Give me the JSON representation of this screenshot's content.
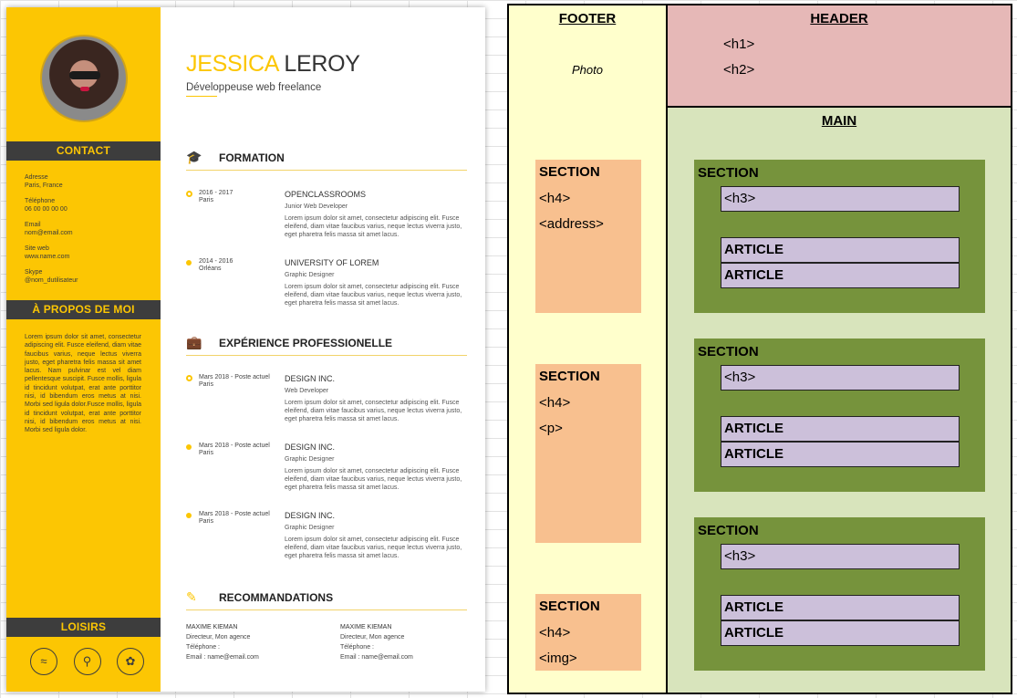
{
  "cv": {
    "first_name": "JESSICA",
    "last_name": "LEROY",
    "job_title": "Développeuse web freelance",
    "contact_title": "CONTACT",
    "contacts": [
      {
        "label": "Adresse",
        "value": "Paris, France"
      },
      {
        "label": "Téléphone",
        "value": "06 00 00 00 00"
      },
      {
        "label": "Email",
        "value": "nom@email.com"
      },
      {
        "label": "Site web",
        "value": "www.name.com"
      },
      {
        "label": "Skype",
        "value": "@nom_dutilisateur"
      }
    ],
    "about_title": "À PROPOS DE MOI",
    "about_text": "Lorem ipsum dolor sit amet, consectetur adipiscing elit. Fusce eleifend, diam vitae faucibus varius, neque lectus viverra justo, eget pharetra felis massa sit amet lacus. Nam pulvinar est vel diam pellentesque suscipit. Fusce mollis, ligula id tincidunt volutpat, erat ante porttitor nisi, id bibendum eros metus at nisi. Morbi sed ligula dolor.Fusce mollis, ligula id tincidunt volutpat, erat ante porttitor nisi, id bibendum eros metus at nisi. Morbi sed ligula dolor.",
    "hobbies_title": "LOISIRS",
    "hobby_icons": [
      "swimming-icon",
      "cycling-icon",
      "running-icon"
    ],
    "education_title": "FORMATION",
    "education": [
      {
        "date": "2016 - 2017",
        "place": "Paris",
        "org": "OPENCLASSROOMS",
        "role": "Junior Web Developer",
        "desc": "Lorem ipsum dolor sit amet, consectetur adipiscing elit. Fusce eleifend, diam vitae faucibus varius, neque lectus viverra justo, eget pharetra felis massa sit amet lacus."
      },
      {
        "date": "2014 - 2016",
        "place": "Orléans",
        "org": "UNIVERSITY OF LOREM",
        "role": "Graphic Designer",
        "desc": "Lorem ipsum dolor sit amet, consectetur adipiscing elit. Fusce eleifend, diam vitae faucibus varius, neque lectus viverra justo, eget pharetra felis massa sit amet lacus."
      }
    ],
    "experience_title": "EXPÉRIENCE PROFESSIONELLE",
    "experience": [
      {
        "date": "Mars 2018 - Poste actuel",
        "place": "Paris",
        "org": "DESIGN INC.",
        "role": "Web Developer",
        "desc": "Lorem ipsum dolor sit amet, consectetur adipiscing elit. Fusce eleifend, diam vitae faucibus varius, neque lectus viverra justo, eget pharetra felis massa sit amet lacus."
      },
      {
        "date": "Mars 2018 - Poste actuel",
        "place": "Paris",
        "org": "DESIGN INC.",
        "role": "Graphic Designer",
        "desc": "Lorem ipsum dolor sit amet, consectetur adipiscing elit. Fusce eleifend, diam vitae faucibus varius, neque lectus viverra justo, eget pharetra felis massa sit amet lacus."
      },
      {
        "date": "Mars 2018 - Poste actuel",
        "place": "Paris",
        "org": "DESIGN INC.",
        "role": "Graphic Designer",
        "desc": "Lorem ipsum dolor sit amet, consectetur adipiscing elit. Fusce eleifend, diam vitae faucibus varius, neque lectus viverra justo, eget pharetra felis massa sit amet lacus."
      }
    ],
    "reco_title": "RECOMMANDATIONS",
    "recommendations": [
      {
        "name": "MAXIME KIEMAN",
        "title": "Directeur, Mon agence",
        "phone": "Téléphone :",
        "email": "Email : name@email.com"
      },
      {
        "name": "MAXIME KIEMAN",
        "title": "Directeur, Mon agence",
        "phone": "Téléphone :",
        "email": "Email : name@email.com"
      }
    ],
    "colors": {
      "accent": "#fcc603",
      "dark": "#3d3d3d"
    }
  },
  "diagram": {
    "footer_title": "FOOTER",
    "photo_label": "Photo",
    "footer_sections": [
      {
        "title": "SECTION",
        "tags": [
          "<h4>",
          "<address>"
        ]
      },
      {
        "title": "SECTION",
        "tags": [
          "<h4>",
          "<p>"
        ]
      },
      {
        "title": "SECTION",
        "tags": [
          "<h4>",
          "<img>"
        ]
      }
    ],
    "header_title": "HEADER",
    "header_tags": [
      "<h1>",
      "<h2>"
    ],
    "main_title": "MAIN",
    "main_sections": [
      {
        "title": "SECTION",
        "heading": "<h3>",
        "articles": [
          "ARTICLE",
          "ARTICLE"
        ]
      },
      {
        "title": "SECTION",
        "heading": "<h3>",
        "articles": [
          "ARTICLE",
          "ARTICLE"
        ]
      },
      {
        "title": "SECTION",
        "heading": "<h3>",
        "articles": [
          "ARTICLE",
          "ARTICLE"
        ]
      }
    ],
    "colors": {
      "footer": "#ffffcc",
      "header": "#e6b8b7",
      "main": "#d8e4bc",
      "orange": "#f8c08f",
      "green": "#76933c",
      "purple": "#ccc0da"
    }
  }
}
